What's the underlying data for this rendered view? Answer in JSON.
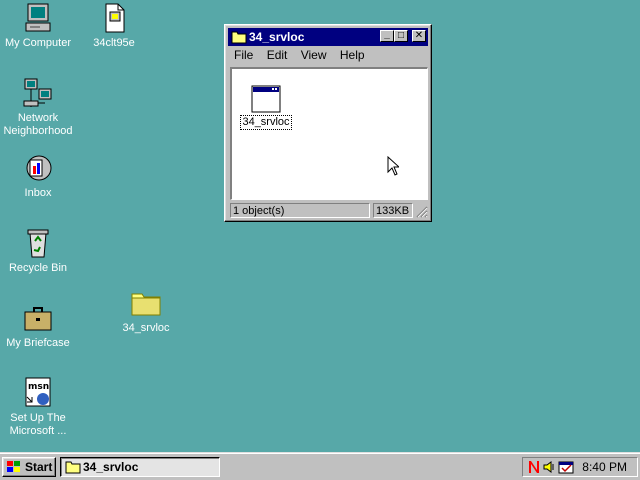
{
  "desktop": {
    "icons": [
      {
        "label": "My Computer"
      },
      {
        "label": "34clt95e"
      },
      {
        "label": "Network\nNeighborhood"
      },
      {
        "label": "Inbox"
      },
      {
        "label": "Recycle Bin"
      },
      {
        "label": "My Briefcase"
      },
      {
        "label": "34_srvloc"
      },
      {
        "label": "Set Up The\nMicrosoft ..."
      }
    ]
  },
  "window": {
    "title": "34_srvloc",
    "buttons": {
      "minimize": "_",
      "maximize": "□",
      "close": "✕"
    },
    "menu": [
      "File",
      "Edit",
      "View",
      "Help"
    ],
    "item_label": "34_srvloc",
    "status": {
      "objects": "1 object(s)",
      "size": "133KB"
    }
  },
  "taskbar": {
    "start_label": "Start",
    "task_label": "34_srvloc",
    "clock": "8:40 PM"
  },
  "colors": {
    "desktop": "#57a8a8",
    "titlebar": "#000080",
    "face": "#c0c0c0"
  }
}
